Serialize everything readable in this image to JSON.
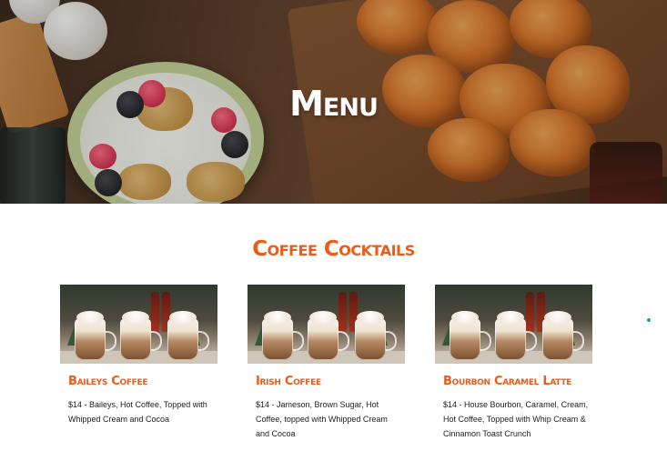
{
  "hero": {
    "title": "Menu"
  },
  "section": {
    "title": "Coffee Cocktails"
  },
  "items": [
    {
      "name": "Baileys Coffee",
      "description": "$14 - Baileys, Hot Coffee, Topped with Whipped Cream and Cocoa"
    },
    {
      "name": "Irish Coffee",
      "description": "$14 - Jameson, Brown Sugar, Hot Coffee, topped with Whipped Cream and Cocoa"
    },
    {
      "name": "Bourbon Caramel Latte",
      "description": "$14 - House Bourbon, Caramel, Cream, Hot Coffee, Topped with Whip Cream & Cinnamon Toast Crunch"
    }
  ],
  "colors": {
    "accent": "#ef5a16",
    "text": "#222222",
    "indicator": "#1aa0a8"
  }
}
